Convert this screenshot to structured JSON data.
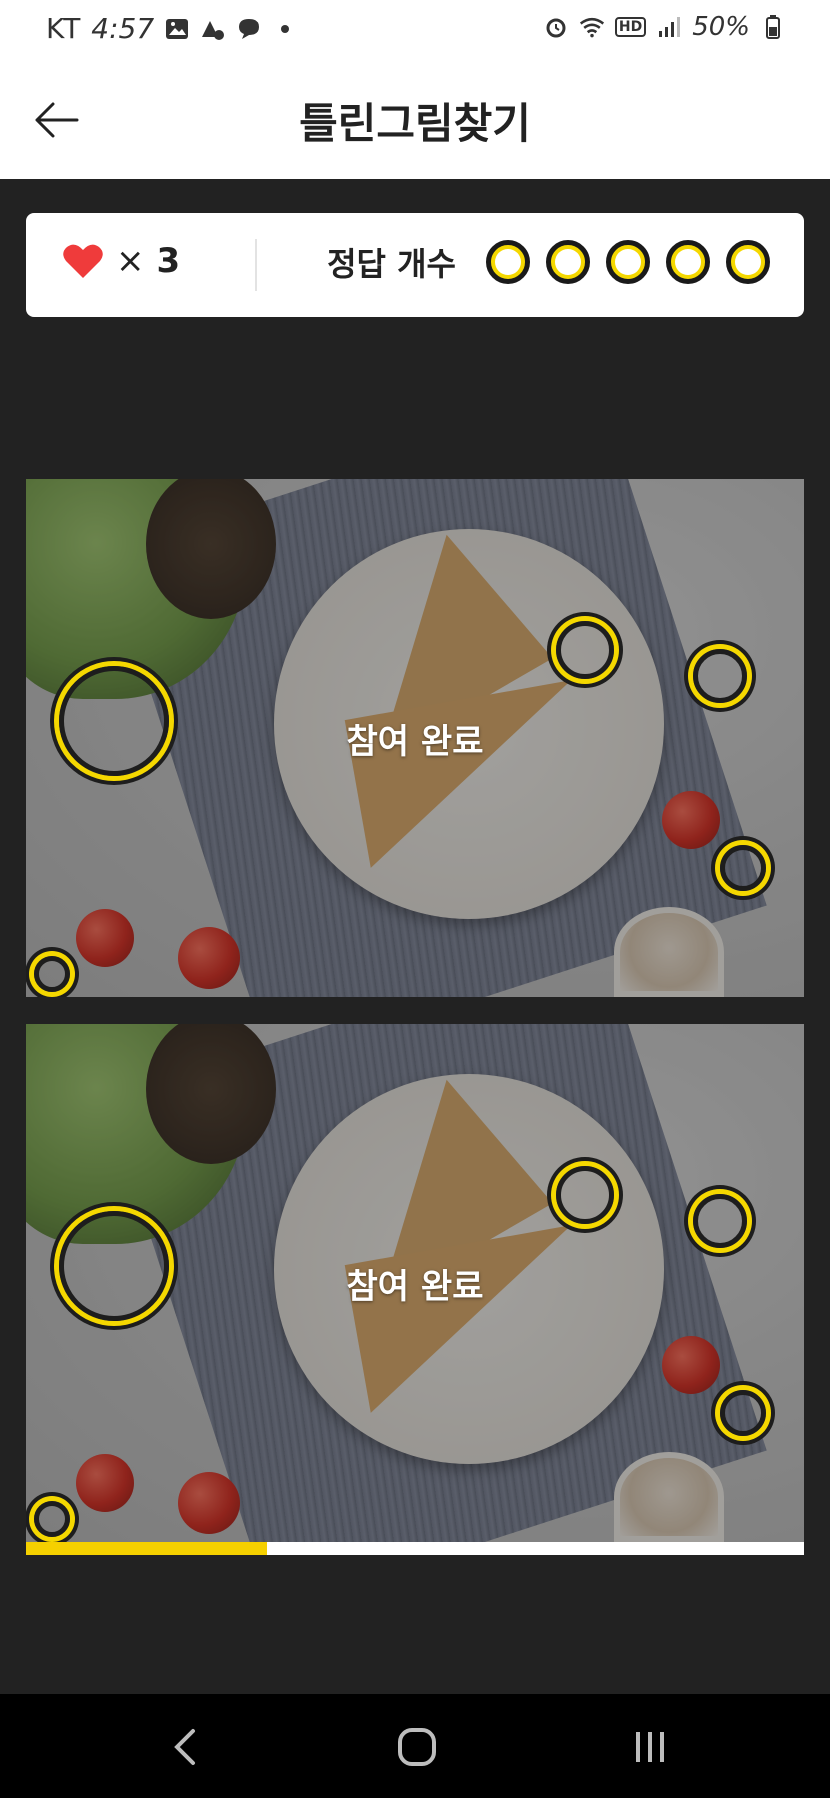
{
  "status_bar": {
    "carrier": "KT",
    "time": "4:57",
    "hd_label": "HD",
    "battery_percent": "50%"
  },
  "header": {
    "title": "틀린그림찾기",
    "back_icon": "arrow-left-icon"
  },
  "score": {
    "lives_symbol": "×",
    "lives_count": "3",
    "answers_label": "정답 개수",
    "answers_total": 5,
    "answers_found": 0
  },
  "panels": {
    "top_label": "참여 완료",
    "bottom_label": "참여 완료"
  },
  "progress": {
    "fraction": 0.31
  },
  "colors": {
    "accent_yellow": "#f5d800",
    "heart_red": "#ef3b3b",
    "background_dark": "#222222"
  },
  "nav": {
    "back_icon": "chevron-left-icon",
    "home_icon": "home-icon",
    "recents_icon": "recents-icon"
  }
}
